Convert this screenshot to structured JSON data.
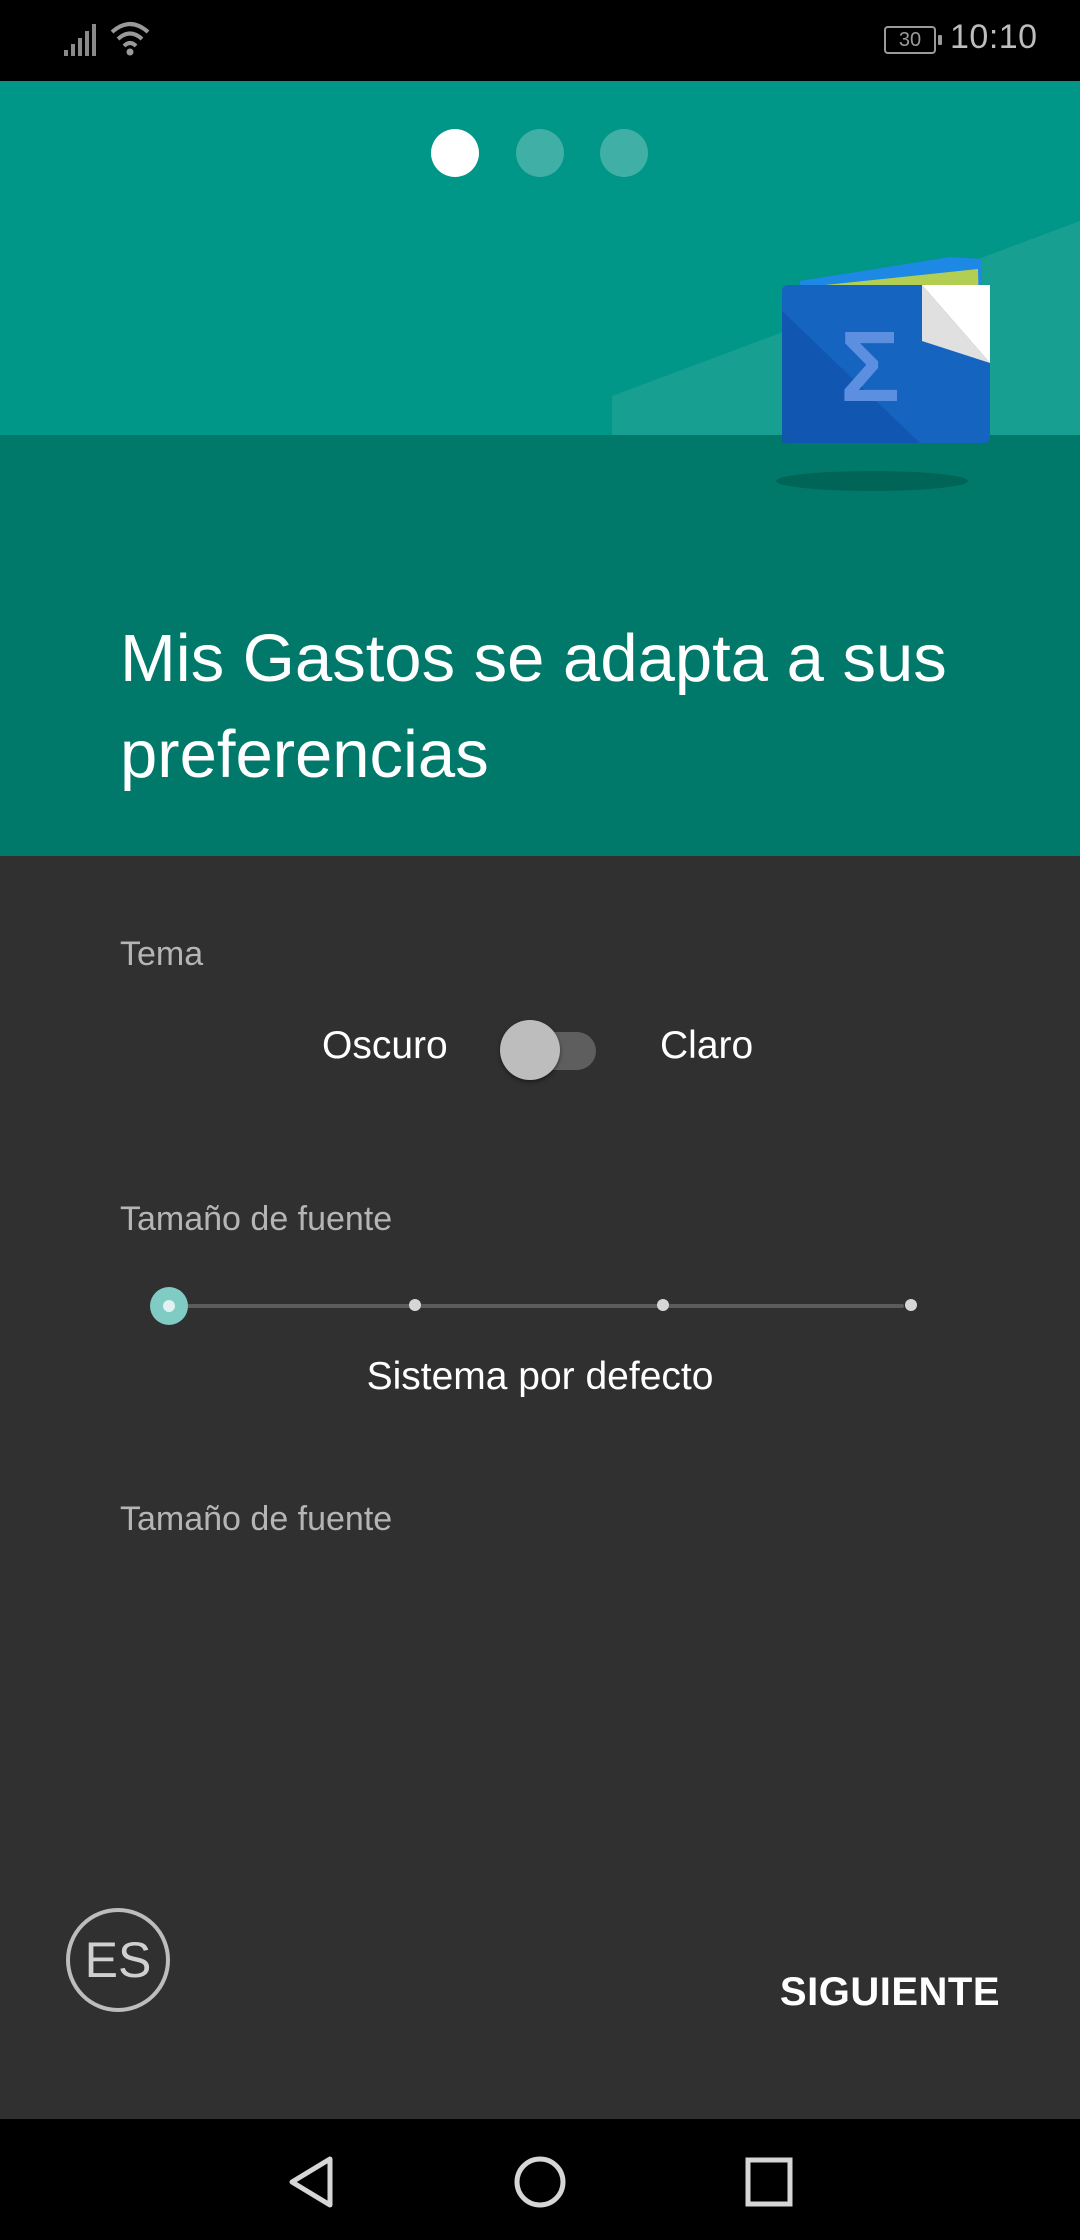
{
  "status_bar": {
    "time": "10:10",
    "battery": "30",
    "icons": [
      "signal-icon",
      "wifi-icon",
      "battery-icon"
    ]
  },
  "onboarding": {
    "page_indicator": {
      "pages": 3,
      "current": 1
    },
    "title": "Mis Gastos se adapta a sus preferencias",
    "logo_icon": "sigma-wallet-icon"
  },
  "theme": {
    "label": "Tema",
    "dark_label": "Oscuro",
    "light_label": "Claro",
    "is_light": false
  },
  "font_size": {
    "label": "Tamaño de fuente",
    "steps": 4,
    "selected_index": 0,
    "value_label": "Sistema por defecto"
  },
  "font_size_2": {
    "label": "Tamaño de fuente"
  },
  "footer": {
    "language": "ES",
    "next_label": "SIGUIENTE"
  },
  "nav_bar": {
    "icons": [
      "back-icon",
      "home-icon",
      "recents-icon"
    ]
  },
  "colors": {
    "teal_light": "#009688",
    "teal_dark": "#00796b",
    "background": "#303030",
    "accent": "#80cbc4"
  }
}
